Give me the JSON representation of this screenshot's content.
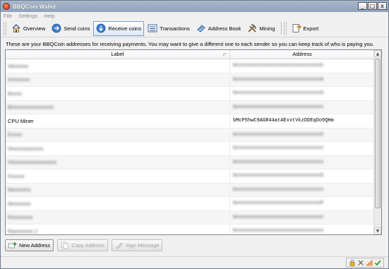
{
  "window": {
    "title": "BBQCoin Wallet",
    "controls": [
      "_",
      "□",
      "x"
    ]
  },
  "menu": [
    "File",
    "Settings",
    "Help"
  ],
  "toolbar": {
    "overview": "Overview",
    "send_coins": "Send coins",
    "receive_coins": "Receive coins",
    "transactions": "Transactions",
    "address_book": "Address Book",
    "mining": "Mining",
    "export": "Export"
  },
  "info_text": "These are your BBQCoin addresses for receiving payments.  You may want to give a different one to each sender so you can keep track of who is paying you.",
  "table": {
    "columns": {
      "label": "Label",
      "address": "Address"
    },
    "rows": [
      {
        "label": "Alxxxxxx",
        "address": "bxxxxxxxxxxxxxxxxxxxxxxxxxxxxxxh",
        "obscured": true
      },
      {
        "label": "Axxxxxxx",
        "address": "bxxxxxxxxxxxxxxxxxxxxxxxxxxxxxxb",
        "obscured": true
      },
      {
        "label": "Bxxxx",
        "address": "bxxxxxxxxxxxxxxxxxxxxxxxxxxxxxxS",
        "obscured": true
      },
      {
        "label": "Bxxxxxxxxxxxxxxxx",
        "address": "bxxxxxxxxxxxxxxxxxxxxxxxxxxxxxxx",
        "obscured": true
      },
      {
        "label": "CPU Miner",
        "address": "bMcP5hwC9AGR44atAExxtVkzDDEqDo9QHm",
        "obscured": false
      },
      {
        "label": "Exxxx",
        "address": "bxxxxxxxxxxxxxxxxxxxxxxxxxxxxxxh",
        "obscured": true
      },
      {
        "label": "Hxxxxxxxxxxxx",
        "address": "bxxxxxxxxxxxxxxxxxxxxxxxxxxxxxxx",
        "obscured": true
      },
      {
        "label": "Hxxxxxxxxxxxxxxxxx",
        "address": "bxxxxxxxxxxxxxxxxxxxxxxxxxxxxxxx",
        "obscured": true
      },
      {
        "label": "Kxxxxx",
        "address": "bxxxxxxxxxxxxxxxxxxxxxxxxxxxxxxS",
        "obscured": true
      },
      {
        "label": "Mxxxxxxx",
        "address": "bxxxxxxxxxxxxxxxxxxxxxxxxxxxxxxx",
        "obscured": true
      },
      {
        "label": "Mxxxxxxx",
        "address": "bxxxxxxxxxxxxxxxxxxxxxxxxxxxxxxP",
        "obscured": true
      },
      {
        "label": "Rxxxxxxxx",
        "address": "bxxxxxxxxxxxxxxxxxxxxxxxxxxxxxxx",
        "obscured": true
      },
      {
        "label": "Raxxxxxxx 2",
        "address": "bxxxxxxxxxxxxxxxxxxxxxxxxxxxxxxx",
        "obscured": true
      }
    ]
  },
  "buttons": {
    "new_address": "New Address",
    "copy_address": "Copy Address",
    "sign_message": "Sign Message"
  },
  "colors": {
    "active_tab_border": "#7aa0c8",
    "titlebar": "#99abc3"
  }
}
